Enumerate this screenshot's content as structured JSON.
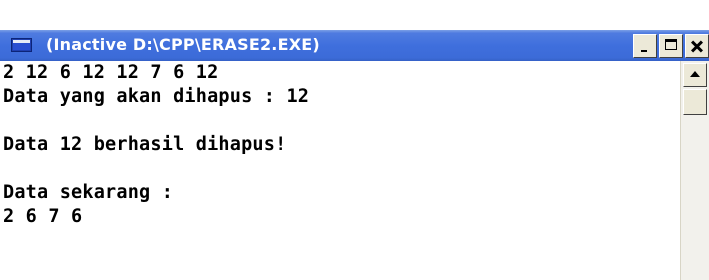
{
  "window": {
    "title": "(Inactive D:\\CPP\\ERASE2.EXE)",
    "app_icon": "console-window-icon",
    "buttons": {
      "minimize": "minimize-icon",
      "maximize": "maximize-icon",
      "close": "close-icon"
    }
  },
  "console": {
    "lines": [
      "2 12 6 12 12 7 6 12",
      "Data yang akan dihapus : 12",
      "",
      "Data 12 berhasil dihapus!",
      "",
      "Data sekarang :",
      "2 6 7 6"
    ]
  },
  "scrollbar": {
    "up_icon": "scroll-up-arrow-icon"
  },
  "colors": {
    "titlebar": "#3c6bd8",
    "console_background": "#ffffff",
    "console_text": "#000000",
    "button_face": "#ece9d8"
  }
}
